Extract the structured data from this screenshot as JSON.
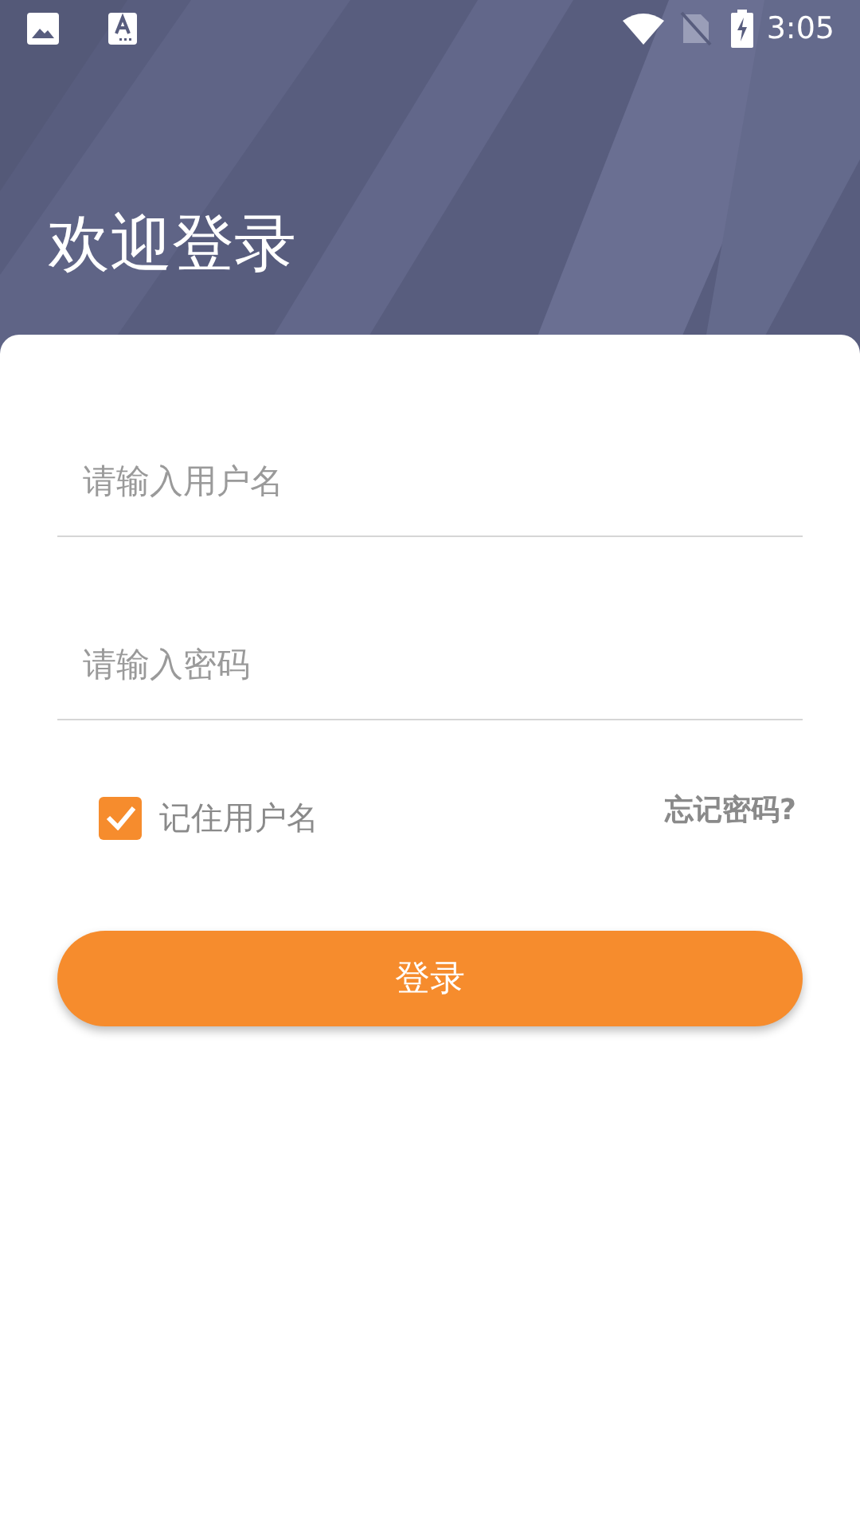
{
  "status_bar": {
    "time": "3:05"
  },
  "header": {
    "title": "欢迎登录"
  },
  "form": {
    "username": {
      "placeholder": "请输入用户名"
    },
    "password": {
      "placeholder": "请输入密码"
    },
    "remember": {
      "label": "记住用户名",
      "checked": true
    },
    "forgot_link": "忘记密码?",
    "login_button": "登录"
  }
}
